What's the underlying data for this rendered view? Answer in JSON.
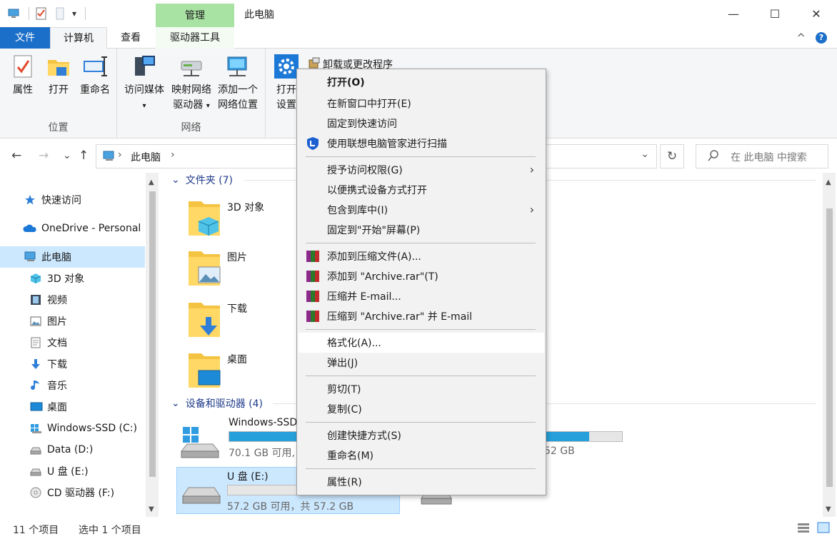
{
  "window": {
    "title": "此电脑",
    "manage_label": "管理",
    "qat_dropdown": "▾",
    "minimize": "—",
    "maximize": "☐",
    "close": "✕"
  },
  "tabs": {
    "file": "文件",
    "computer": "计算机",
    "view": "查看",
    "drive_tools": "驱动器工具",
    "collapse": "^",
    "help": "?"
  },
  "ribbon": {
    "location": {
      "label": "位置",
      "properties": "属性",
      "open": "打开",
      "rename": "重命名"
    },
    "network": {
      "label": "网络",
      "access_media": "访问媒体",
      "map_drive_line1": "映射网络",
      "map_drive_line2": "驱动器",
      "add_location_line1": "添加一个",
      "add_location_line2": "网络位置"
    },
    "system": {
      "open_settings_line1": "打开",
      "open_settings_line2": "设置",
      "uninstall": "卸载或更改程序"
    },
    "dropdown_arrow": "▾"
  },
  "address": {
    "back": "←",
    "forward": "→",
    "recent": "⌄",
    "up": "↑",
    "path": "此电脑",
    "chevron": "›",
    "dropdown": "⌄",
    "refresh": "↻",
    "search_placeholder": "在 此电脑 中搜索"
  },
  "nav_pane": {
    "items": [
      {
        "label": "快速访问",
        "icon": "star-icon"
      },
      {
        "label": "OneDrive - Personal",
        "icon": "cloud-icon"
      },
      {
        "label": "此电脑",
        "icon": "computer-icon"
      },
      {
        "label": "3D 对象",
        "icon": "cube-icon"
      },
      {
        "label": "视频",
        "icon": "film-icon"
      },
      {
        "label": "图片",
        "icon": "picture-icon"
      },
      {
        "label": "文档",
        "icon": "document-icon"
      },
      {
        "label": "下载",
        "icon": "download-icon"
      },
      {
        "label": "音乐",
        "icon": "music-icon"
      },
      {
        "label": "桌面",
        "icon": "desktop-icon"
      },
      {
        "label": "Windows-SSD (C:)",
        "icon": "windows-drive-icon"
      },
      {
        "label": "Data (D:)",
        "icon": "drive-icon"
      },
      {
        "label": "U 盘 (E:)",
        "icon": "drive-icon"
      },
      {
        "label": "CD 驱动器 (F:)",
        "icon": "cd-icon"
      }
    ]
  },
  "content": {
    "group_arrow": "⌄",
    "folders_header": "文件夹 (7)",
    "folders": [
      {
        "label": "3D 对象"
      },
      {
        "label": "图片"
      },
      {
        "label": "下载"
      },
      {
        "label": "桌面"
      }
    ],
    "drives_header": "设备和驱动器 (4)",
    "drives": [
      {
        "name": "Windows-SSD",
        "free": "70.1 GB 可用,",
        "usage_percent": 62
      },
      {
        "name": "",
        "free": "52 GB",
        "usage_percent": 80
      },
      {
        "name": "U 盘 (E:)",
        "free": "57.2 GB 可用，共 57.2 GB",
        "usage_percent": 0
      }
    ]
  },
  "status_bar": {
    "item_count": "11 个项目",
    "selected": "选中 1 个项目"
  },
  "context_menu": {
    "items": [
      {
        "label": "打开(O)"
      },
      {
        "label": "在新窗口中打开(E)"
      },
      {
        "label": "固定到快速访问"
      },
      {
        "label": "使用联想电脑管家进行扫描"
      },
      {
        "label": "授予访问权限(G)"
      },
      {
        "label": "以便携式设备方式打开"
      },
      {
        "label": "包含到库中(I)"
      },
      {
        "label": "固定到\"开始\"屏幕(P)"
      },
      {
        "label": "添加到压缩文件(A)..."
      },
      {
        "label": "添加到 \"Archive.rar\"(T)"
      },
      {
        "label": "压缩并 E-mail..."
      },
      {
        "label": "压缩到 \"Archive.rar\" 并 E-mail"
      },
      {
        "label": "格式化(A)..."
      },
      {
        "label": "弹出(J)"
      },
      {
        "label": "剪切(T)"
      },
      {
        "label": "复制(C)"
      },
      {
        "label": "创建快捷方式(S)"
      },
      {
        "label": "重命名(M)"
      },
      {
        "label": "属性(R)"
      }
    ],
    "submenu_arrow": "›"
  },
  "colors": {
    "accent": "#1c6fc9",
    "manage_tab": "#a9e3a4",
    "selection": "#cce8ff",
    "drive_bar": "#26a0da"
  }
}
